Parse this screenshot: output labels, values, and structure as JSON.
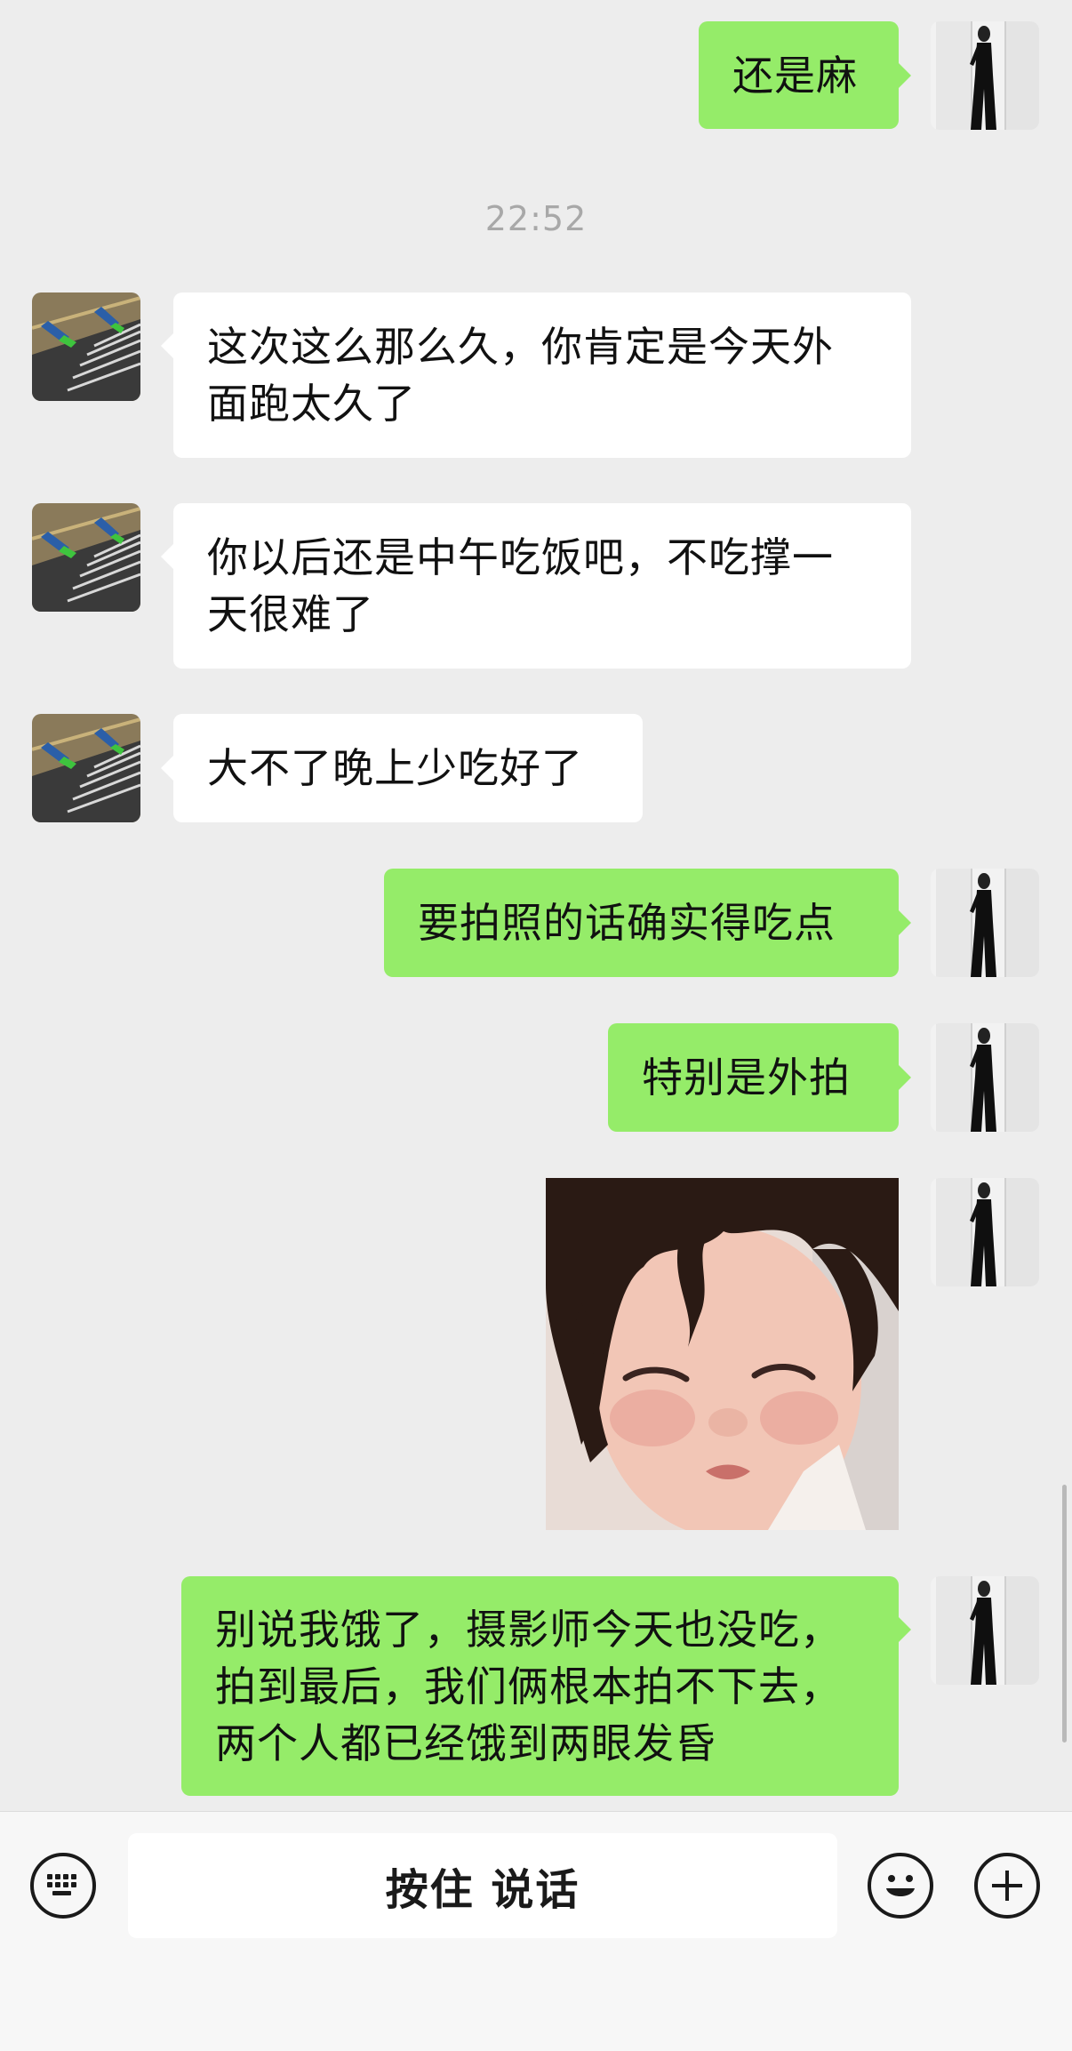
{
  "chat": {
    "timestamp": "22:52",
    "messages": [
      {
        "from": "me",
        "type": "text",
        "text": "还是麻"
      },
      {
        "from": "other",
        "type": "text",
        "text": "这次这么那么久，你肯定是今天外\n面跑太久了"
      },
      {
        "from": "other",
        "type": "text",
        "text": "你以后还是中午吃饭吧，不吃撑一\n天很难了"
      },
      {
        "from": "other",
        "type": "text",
        "text": "大不了晚上少吃好了"
      },
      {
        "from": "me",
        "type": "text",
        "text": "要拍照的话确实得吃点"
      },
      {
        "from": "me",
        "type": "text",
        "text": "特别是外拍"
      },
      {
        "from": "me",
        "type": "sticker",
        "description": "sleepy-toddler-sticker"
      },
      {
        "from": "me",
        "type": "text",
        "text": "别说我饿了，摄影师今天也没吃，\n拍到最后，我们俩根本拍不下去，\n两个人都已经饿到两眼发昏"
      }
    ]
  },
  "input_bar": {
    "voice_label": "按住 说话",
    "left_icon": "keyboard-icon",
    "emoji_icon": "emoji-icon",
    "plus_icon": "plus-icon"
  },
  "colors": {
    "background": "#ededed",
    "my_bubble": "#95ec69",
    "their_bubble": "#ffffff",
    "timestamp": "#a8a8a8"
  }
}
